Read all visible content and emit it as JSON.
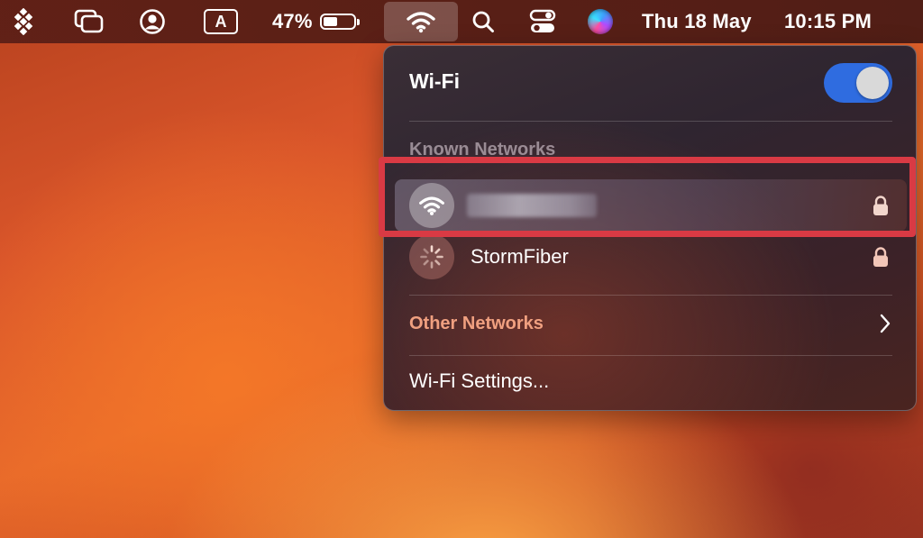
{
  "menubar": {
    "battery_percent": "47%",
    "battery_level": 0.47,
    "keyboard_input": "A",
    "date": "Thu 18 May",
    "time": "10:15 PM",
    "icons": [
      "app-grid-icon",
      "screens-icon",
      "user-icon",
      "input-source-icon",
      "battery-icon",
      "wifi-icon",
      "search-icon",
      "control-center-icon",
      "siri-icon"
    ]
  },
  "wifi_panel": {
    "title": "Wi-Fi",
    "toggle_on": true,
    "toggle_color": "#2f6ce0",
    "known_label": "Known Networks",
    "networks": [
      {
        "name": "",
        "name_redacted": true,
        "icon": "wifi-icon",
        "secured": true,
        "connected": true
      },
      {
        "name": "StormFiber",
        "icon": "loading-spinner-icon",
        "secured": true,
        "connected": false
      }
    ],
    "other_label": "Other Networks",
    "settings_label": "Wi-Fi Settings..."
  },
  "annotation": {
    "highlight_color": "#d93a44"
  }
}
